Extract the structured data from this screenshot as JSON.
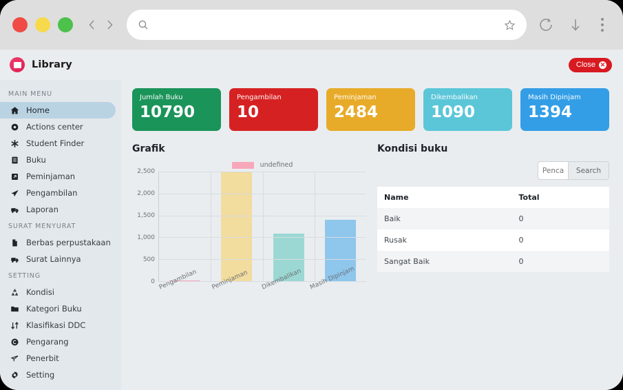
{
  "browser": {
    "traffic_lights": [
      "close",
      "minimize",
      "maximize"
    ],
    "back_label": "Back",
    "forward_label": "Forward",
    "url_value": "",
    "url_placeholder": "",
    "reload_label": "Reload",
    "download_label": "Downloads",
    "menu_label": "More"
  },
  "app": {
    "brand": "Library",
    "close_label": "Close",
    "close_icon": "x"
  },
  "sidebar": {
    "sections": [
      {
        "title": "MAIN MENU",
        "items": [
          {
            "label": "Home",
            "icon": "home-icon",
            "active": true
          },
          {
            "label": "Actions center",
            "icon": "record-icon",
            "active": false
          },
          {
            "label": "Student Finder",
            "icon": "asterisk-icon",
            "active": false
          },
          {
            "label": "Buku",
            "icon": "book-icon",
            "active": false
          },
          {
            "label": "Peminjaman",
            "icon": "external-link-icon",
            "active": false
          },
          {
            "label": "Pengambilan",
            "icon": "paper-plane-icon",
            "active": false
          },
          {
            "label": "Laporan",
            "icon": "report-icon",
            "active": false
          }
        ]
      },
      {
        "title": "SURAT MENYURAT",
        "items": [
          {
            "label": "Berbas perpustakaan",
            "icon": "document-icon",
            "active": false
          },
          {
            "label": "Surat Lainnya",
            "icon": "report-icon",
            "active": false
          }
        ]
      },
      {
        "title": "SETTING",
        "items": [
          {
            "label": "Kondisi",
            "icon": "recycle-icon",
            "active": false
          },
          {
            "label": "Kategori Buku",
            "icon": "folder-icon",
            "active": false
          },
          {
            "label": "Klasifikasi DDC",
            "icon": "sort-icon",
            "active": false
          },
          {
            "label": "Pengarang",
            "icon": "copyright-icon",
            "active": false
          },
          {
            "label": "Penerbit",
            "icon": "share-icon",
            "active": false
          },
          {
            "label": "Setting",
            "icon": "gear-icon",
            "active": false
          }
        ]
      }
    ]
  },
  "cards": [
    {
      "label": "Jumlah Buku",
      "value": "10790",
      "color": "#1a9459"
    },
    {
      "label": "Pengambilan",
      "value": "10",
      "color": "#d62122"
    },
    {
      "label": "Peminjaman",
      "value": "2484",
      "color": "#e8ab29"
    },
    {
      "label": "Dikembalikan",
      "value": "1090",
      "color": "#5bc6d8"
    },
    {
      "label": "Masih Dipinjam",
      "value": "1394",
      "color": "#339ee6"
    }
  ],
  "chart_panel": {
    "title": "Grafik"
  },
  "condition_panel": {
    "title": "Kondisi buku",
    "search_value": "",
    "search_placeholder": "Pencarian",
    "search_button": "Search",
    "columns": [
      "Name",
      "Total"
    ],
    "rows": [
      {
        "name": "Baik",
        "total": "0"
      },
      {
        "name": "Rusak",
        "total": "0"
      },
      {
        "name": "Sangat Baik",
        "total": "0"
      }
    ]
  },
  "chart_data": {
    "type": "bar",
    "title": "Grafik",
    "xlabel": "",
    "ylabel": "",
    "categories": [
      "Pengambilan",
      "Peminjaman",
      "Dikembalikan",
      "Masih Dipinjam"
    ],
    "values": [
      10,
      2484,
      1090,
      1394
    ],
    "bar_colors": [
      "#f7a8bb",
      "#f2dc9e",
      "#9bd8d3",
      "#8ec6ec"
    ],
    "ylim": [
      0,
      2500
    ],
    "yticks": [
      "0",
      "500",
      "1,000",
      "1,500",
      "2,000",
      "2,500"
    ],
    "ytick_values": [
      0,
      500,
      1000,
      1500,
      2000,
      2500
    ],
    "grid": true,
    "legend": [
      {
        "name": "undefined",
        "color": "#f7a8bb"
      }
    ],
    "legend_position": "top-center",
    "xtick_rotation": -24
  }
}
